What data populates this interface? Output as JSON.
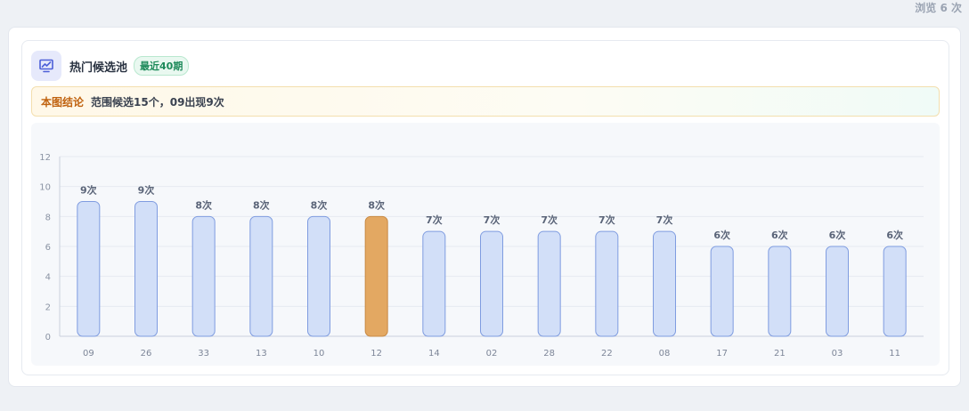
{
  "view_count": "浏览 6 次",
  "card": {
    "title": "热门候选池",
    "badge": "最近40期",
    "icon": "chart-icon"
  },
  "conclusion": {
    "label": "本图结论",
    "text": "范围候选15个，09出现9次"
  },
  "colors": {
    "bar_fill": "#d2dff8",
    "bar_stroke": "#7f9ce0",
    "highlight_fill": "#e3a862",
    "highlight_stroke": "#c88a45",
    "label": "#5a6478"
  },
  "chart_data": {
    "type": "bar",
    "categories": [
      "09",
      "26",
      "33",
      "13",
      "10",
      "12",
      "14",
      "02",
      "28",
      "22",
      "08",
      "17",
      "21",
      "03",
      "11"
    ],
    "values": [
      9,
      9,
      8,
      8,
      8,
      8,
      7,
      7,
      7,
      7,
      7,
      6,
      6,
      6,
      6
    ],
    "data_labels": [
      "9次",
      "9次",
      "8次",
      "8次",
      "8次",
      "8次",
      "7次",
      "7次",
      "7次",
      "7次",
      "7次",
      "6次",
      "6次",
      "6次",
      "6次"
    ],
    "highlight_category": "12",
    "ylim": [
      0,
      12
    ],
    "yticks": [
      0,
      2,
      4,
      6,
      8,
      10,
      12
    ],
    "grid": true
  }
}
